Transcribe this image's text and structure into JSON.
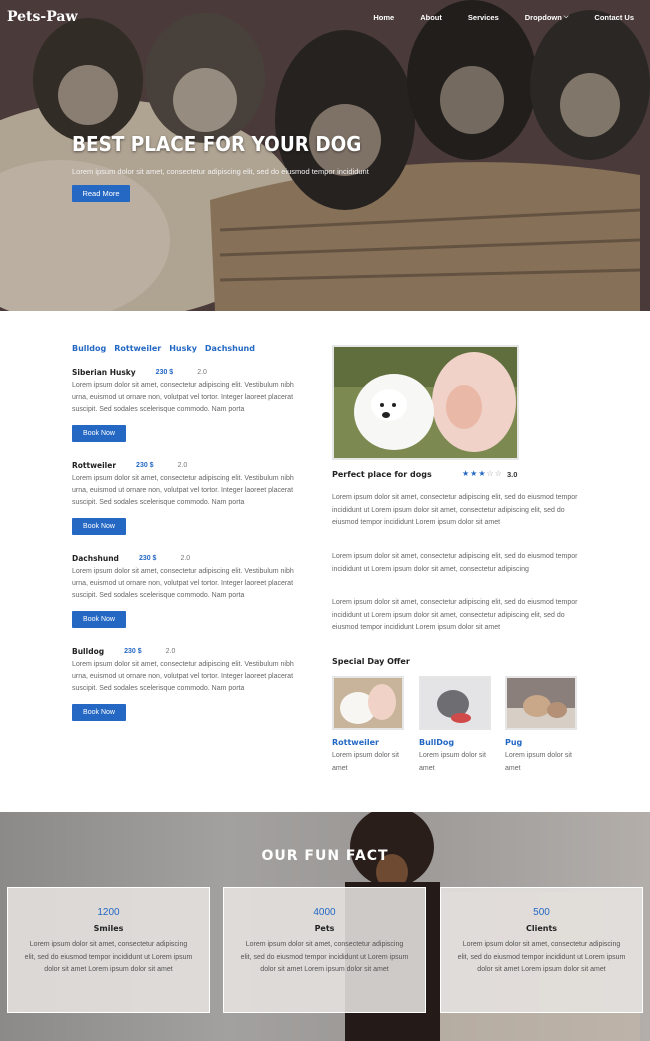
{
  "brand": "Pets-Paw",
  "nav": {
    "items": [
      "Home",
      "About",
      "Services",
      "Dropdown",
      "Contact Us"
    ]
  },
  "hero": {
    "title": "BEST PLACE FOR YOUR DOG",
    "subtitle": "Lorem ipsum dolor sit amet, consectetur adipiscing elit, sed do eiusmod tempor incididunt",
    "button": "Read More"
  },
  "tabs": [
    "Bulldog",
    "Rottweiler",
    "Husky",
    "Dachshund"
  ],
  "items": [
    {
      "name": "Siberian Husky",
      "price": "230 $",
      "qty": "2.0",
      "desc": "Lorem ipsum dolor sit amet, consectetur adipiscing elit. Vestibulum nibh urna, euismod ut ornare non, volutpat vel tortor. Integer laoreet placerat suscipit. Sed sodales scelerisque commodo. Nam porta",
      "button": "Book Now"
    },
    {
      "name": "Rottweiler",
      "price": "230 $",
      "qty": "2.0",
      "desc": "Lorem ipsum dolor sit amet, consectetur adipiscing elit. Vestibulum nibh urna, euismod ut ornare non, volutpat vel tortor. Integer laoreet placerat suscipit. Sed sodales scelerisque commodo. Nam porta",
      "button": "Book Now"
    },
    {
      "name": "Dachshund",
      "price": "230 $",
      "qty": "2.0",
      "desc": "Lorem ipsum dolor sit amet, consectetur adipiscing elit. Vestibulum nibh urna, euismod ut ornare non, volutpat vel tortor. Integer laoreet placerat suscipit. Sed sodales scelerisque commodo. Nam porta",
      "button": "Book Now"
    },
    {
      "name": "Bulldog",
      "price": "230 $",
      "qty": "2.0",
      "desc": "Lorem ipsum dolor sit amet, consectetur adipiscing elit. Vestibulum nibh urna, euismod ut ornare non, volutpat vel tortor. Integer laoreet placerat suscipit. Sed sodales scelerisque commodo. Nam porta",
      "button": "Book Now"
    }
  ],
  "feature": {
    "title": "Perfect place for dogs",
    "rating": "3.0",
    "rating_value": 3,
    "rating_max": 5,
    "paragraphs": [
      "Lorem ipsum dolor sit amet, consectetur adipiscing elit, sed do eiusmod tempor incididunt ut Lorem ipsum dolor sit amet, consectetur adipiscing elit, sed do eiusmod tempor incididunt Lorem ipsum dolor sit amet",
      "Lorem ipsum dolor sit amet, consectetur adipiscing elit, sed do eiusmod tempor incididunt ut Lorem ipsum dolor sit amet, consectetur adipiscing",
      "Lorem ipsum dolor sit amet, consectetur adipiscing elit, sed do eiusmod tempor incididunt ut Lorem ipsum dolor sit amet, consectetur adipiscing elit, sed do eiusmod tempor incididunt Lorem ipsum dolor sit amet"
    ]
  },
  "special": {
    "title": "Special Day Offer",
    "offers": [
      {
        "name": "Rottweiler",
        "desc": "Lorem ipsum dolor sit amet"
      },
      {
        "name": "BullDog",
        "desc": "Lorem ipsum dolor sit amet"
      },
      {
        "name": "Pug",
        "desc": "Lorem ipsum dolor sit amet"
      }
    ]
  },
  "fun": {
    "title": "OUR FUN FACT",
    "facts": [
      {
        "number": "1200",
        "label": "Smiles",
        "desc": "Lorem ipsum dolor sit amet, consectetur adipiscing elit, sed do eiusmod tempor incididunt ut Lorem ipsum dolor sit amet Lorem ipsum dolor sit amet"
      },
      {
        "number": "4000",
        "label": "Pets",
        "desc": "Lorem ipsum dolor sit amet, consectetur adipiscing elit, sed do eiusmod tempor incididunt ut Lorem ipsum dolor sit amet Lorem ipsum dolor sit amet"
      },
      {
        "number": "500",
        "label": "Clients",
        "desc": "Lorem ipsum dolor sit amet, consectetur adipiscing elit, sed do eiusmod tempor incididunt ut Lorem ipsum dolor sit amet Lorem ipsum dolor sit amet"
      }
    ]
  },
  "colors": {
    "accent": "#2468c4"
  }
}
